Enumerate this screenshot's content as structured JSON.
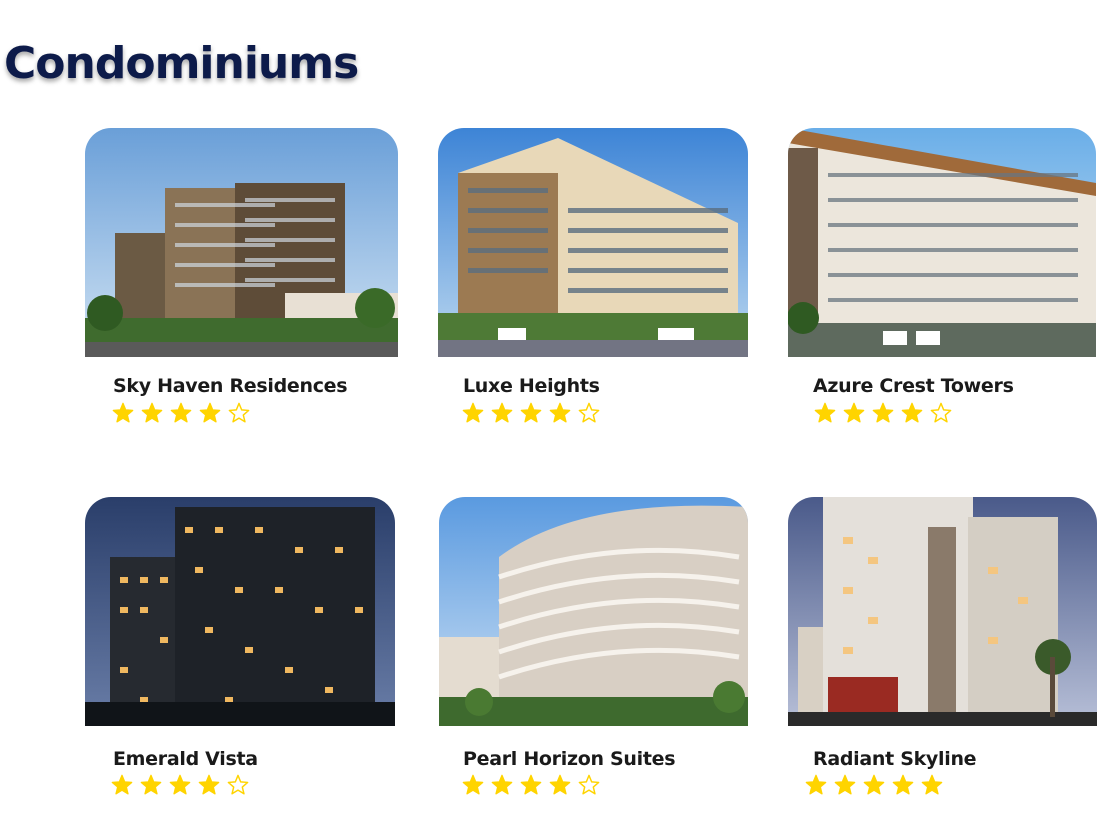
{
  "page": {
    "title": "Condominiums"
  },
  "listings": [
    {
      "name": "Sky Haven Residences",
      "rating": 4,
      "max_rating": 5,
      "image_alt": "building photo"
    },
    {
      "name": "Luxe Heights",
      "rating": 4,
      "max_rating": 5,
      "image_alt": "building photo"
    },
    {
      "name": "Azure Crest Towers",
      "rating": 4,
      "max_rating": 5,
      "image_alt": "building photo"
    },
    {
      "name": "Emerald Vista",
      "rating": 4,
      "max_rating": 5,
      "image_alt": "building photo"
    },
    {
      "name": "Pearl Horizon Suites",
      "rating": 4,
      "max_rating": 5,
      "image_alt": "building photo"
    },
    {
      "name": "Radiant Skyline",
      "rating": 5,
      "max_rating": 5,
      "image_alt": "building photo"
    }
  ],
  "colors": {
    "title": "#0d1b4a",
    "star": "#ffd400",
    "text": "#1a1a1a"
  }
}
